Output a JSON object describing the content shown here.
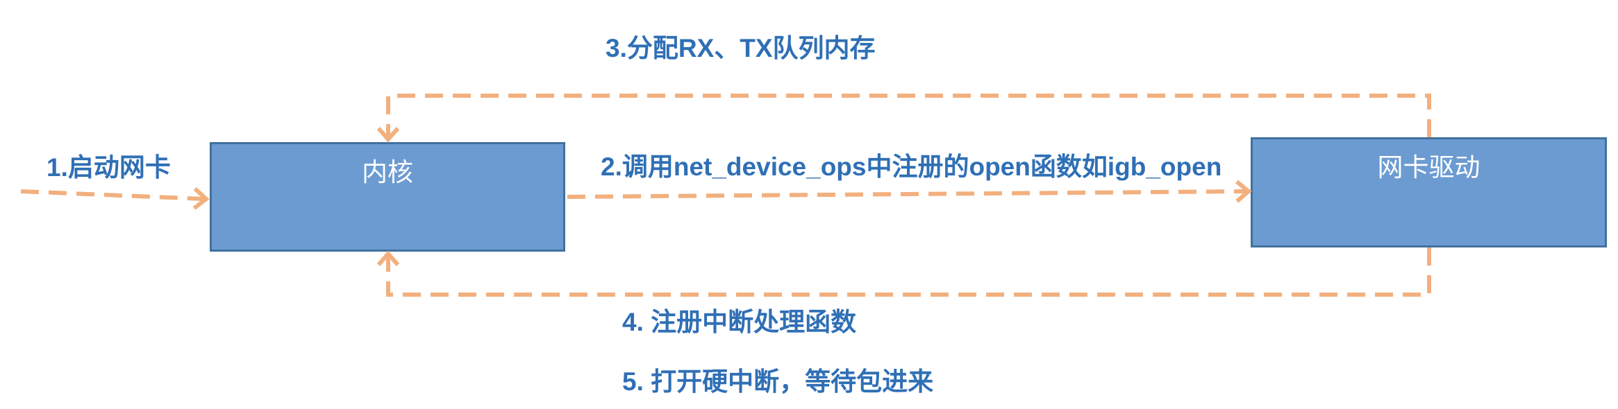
{
  "diagram": {
    "nodes": {
      "kernel": "内核",
      "nic_driver": "网卡驱动"
    },
    "edges": {
      "start_nic": "1.启动网卡",
      "call_open": "2.调用net_device_ops中注册的open函数如igb_open",
      "alloc_queues": "3.分配RX、TX队列内存",
      "register_irq": "4. 注册中断处理函数",
      "enable_irq": "5. 打开硬中断，等待包进来"
    }
  },
  "colors": {
    "node_fill": "#6b9bd1",
    "node_border": "#41719c",
    "node_text": "#ffffff",
    "arrow": "#f2b07e",
    "label_text": "#2f6fb5"
  }
}
